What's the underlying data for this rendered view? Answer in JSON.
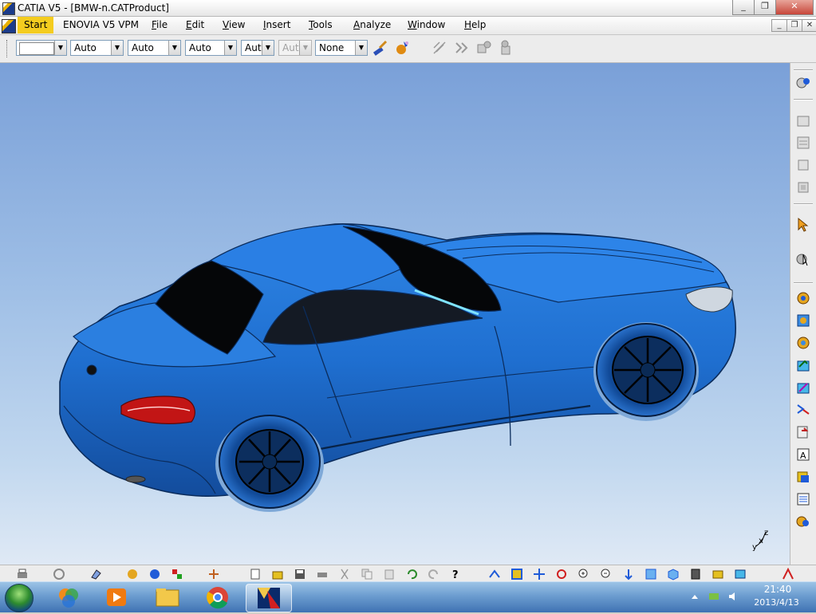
{
  "window": {
    "title": "CATIA V5 - [BMW-n.CATProduct]",
    "min": "_",
    "restore": "❐",
    "close": "✕"
  },
  "menubar": {
    "start": "Start",
    "enovia": "ENOVIA V5 VPM",
    "items": [
      {
        "key": "F",
        "rest": "ile"
      },
      {
        "key": "E",
        "rest": "dit"
      },
      {
        "key": "V",
        "rest": "iew"
      },
      {
        "key": "I",
        "rest": "nsert"
      },
      {
        "key": "T",
        "rest": "ools"
      },
      {
        "key": "A",
        "rest": "nalyze"
      },
      {
        "key": "W",
        "rest": "indow"
      },
      {
        "key": "H",
        "rest": "elp"
      }
    ]
  },
  "toolbar": {
    "combos": [
      "",
      "Auto",
      "Auto",
      "Auto",
      "Aut",
      "Aut",
      "None"
    ]
  },
  "compass": {
    "z": "z",
    "x": "x",
    "y": "y"
  },
  "taskbar": {
    "time": "21:40",
    "date": "2013/4/13"
  },
  "colors": {
    "car_body": "#1f6fd0",
    "viewport_top": "#7aa0d8",
    "viewport_bottom": "#dfe9f5",
    "menu_highlight": "#f4cc1f"
  }
}
